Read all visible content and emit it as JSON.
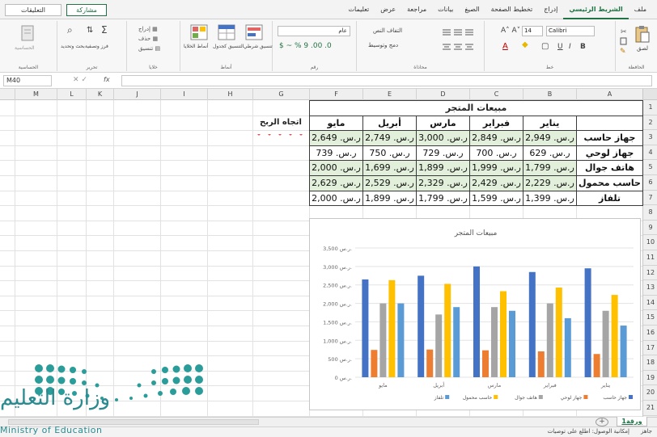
{
  "ribbon": {
    "tabs": [
      "ملف",
      "الشريط الرئيسي",
      "إدراج",
      "تخطيط الصفحة",
      "الصيغ",
      "بيانات",
      "مراجعة",
      "عرض",
      "تعليمات"
    ],
    "active_tab": "الشريط الرئيسي",
    "share_label": "مشاركة",
    "comments_label": "التعليقات",
    "paste_label": "لصق",
    "clipboard_label": "الحافظة",
    "font_name": "Calibri",
    "font_size": "14",
    "font_group_label": "خط",
    "alignment_label": "محاذاة",
    "wrap_text": "التفاف النص",
    "merge_center": "دمج وتوسيط",
    "number_format": "عام",
    "number_label": "رقم",
    "cond_format": "تنسيق شرطي",
    "format_table": "التنسيق كجدول",
    "cell_styles": "أنماط الخلايا",
    "styles_label": "أنماط",
    "insert_cells": "إدراج",
    "delete_cells": "حذف",
    "format_cells": "تنسيق",
    "cells_label": "خلايا",
    "sort_filter": "فرز وتصفية",
    "find_select": "بحث وتحديد",
    "editing_label": "تحرير",
    "sensitivity_label": "الحساسية",
    "sensitivity_group": "الحساسية"
  },
  "formula_bar": {
    "name_box": "M40",
    "fx": "fx",
    "content": ""
  },
  "columns": [
    "A",
    "B",
    "C",
    "D",
    "E",
    "F",
    "G",
    "H",
    "I",
    "J",
    "K",
    "L",
    "M"
  ],
  "rows": [
    "1",
    "2",
    "3",
    "4",
    "5",
    "6",
    "7",
    "8",
    "9",
    "10",
    "11",
    "12",
    "13",
    "14",
    "15",
    "16",
    "17",
    "18",
    "19",
    "20",
    "21"
  ],
  "table": {
    "title": "مبيعات المتجر",
    "months": [
      "يناير",
      "فبراير",
      "مارس",
      "أبريل",
      "مايو"
    ],
    "trend_header": "اتجاه الربح",
    "rows": [
      {
        "product": "جهاز حاسب",
        "values": [
          "ر.س. 2,949",
          "ر.س. 2,849",
          "ر.س. 3,000",
          "ر.س. 2,749",
          "ر.س. 2,649"
        ],
        "green": true
      },
      {
        "product": "جهاز لوحي",
        "values": [
          "ر.س. 629",
          "ر.س. 700",
          "ر.س. 729",
          "ر.س. 750",
          "ر.س. 739"
        ],
        "green": false
      },
      {
        "product": "هاتف جوال",
        "values": [
          "ر.س. 1,799",
          "ر.س. 1,999",
          "ر.س. 1,899",
          "ر.س. 1,699",
          "ر.س. 2,000"
        ],
        "green": true
      },
      {
        "product": "حاسب محمول",
        "values": [
          "ر.س. 2,229",
          "ر.س. 2,429",
          "ر.س. 2,329",
          "ر.س. 2,529",
          "ر.س. 2,629"
        ],
        "green": true
      },
      {
        "product": "تلفاز",
        "values": [
          "ر.س. 1,399",
          "ر.س. 1,599",
          "ر.س. 1,799",
          "ر.س. 1,899",
          "ر.س. 2,000"
        ],
        "green": false
      }
    ]
  },
  "chart_data": {
    "type": "bar",
    "title": "مبيعات المتجر",
    "categories": [
      "يناير",
      "فبراير",
      "مارس",
      "أبريل",
      "مايو"
    ],
    "ylim": [
      0,
      3500
    ],
    "yticks": [
      "0 ر.س.",
      "500 ر.س.",
      "1,000 ر.س.",
      "1,500 ر.س.",
      "2,000 ر.س.",
      "2,500 ر.س.",
      "3,000 ر.س.",
      "3,500 ر.س."
    ],
    "series": [
      {
        "name": "جهاز حاسب",
        "color": "#4472c4",
        "values": [
          2949,
          2849,
          3000,
          2749,
          2649
        ]
      },
      {
        "name": "جهاز لوحي",
        "color": "#ed7d31",
        "values": [
          629,
          700,
          729,
          750,
          739
        ]
      },
      {
        "name": "هاتف جوال",
        "color": "#a5a5a5",
        "values": [
          1799,
          1999,
          1899,
          1699,
          2000
        ]
      },
      {
        "name": "حاسب محمول",
        "color": "#ffc000",
        "values": [
          2229,
          2429,
          2329,
          2529,
          2629
        ]
      },
      {
        "name": "تلفاز",
        "color": "#5b9bd5",
        "values": [
          1399,
          1599,
          1799,
          1899,
          2000
        ]
      }
    ],
    "legend": "bottom"
  },
  "sheet": {
    "tab_name": "ورقة1",
    "add_sheet": "+"
  },
  "status": {
    "ready": "جاهز",
    "accessibility": "إمكانية الوصول: اطلع على توصيات"
  },
  "logo": {
    "text_ar": "وزارة التعليم",
    "text_en": "Ministry of Education"
  },
  "colors": {
    "accent": "#217346",
    "table_green": "#e2efda"
  }
}
